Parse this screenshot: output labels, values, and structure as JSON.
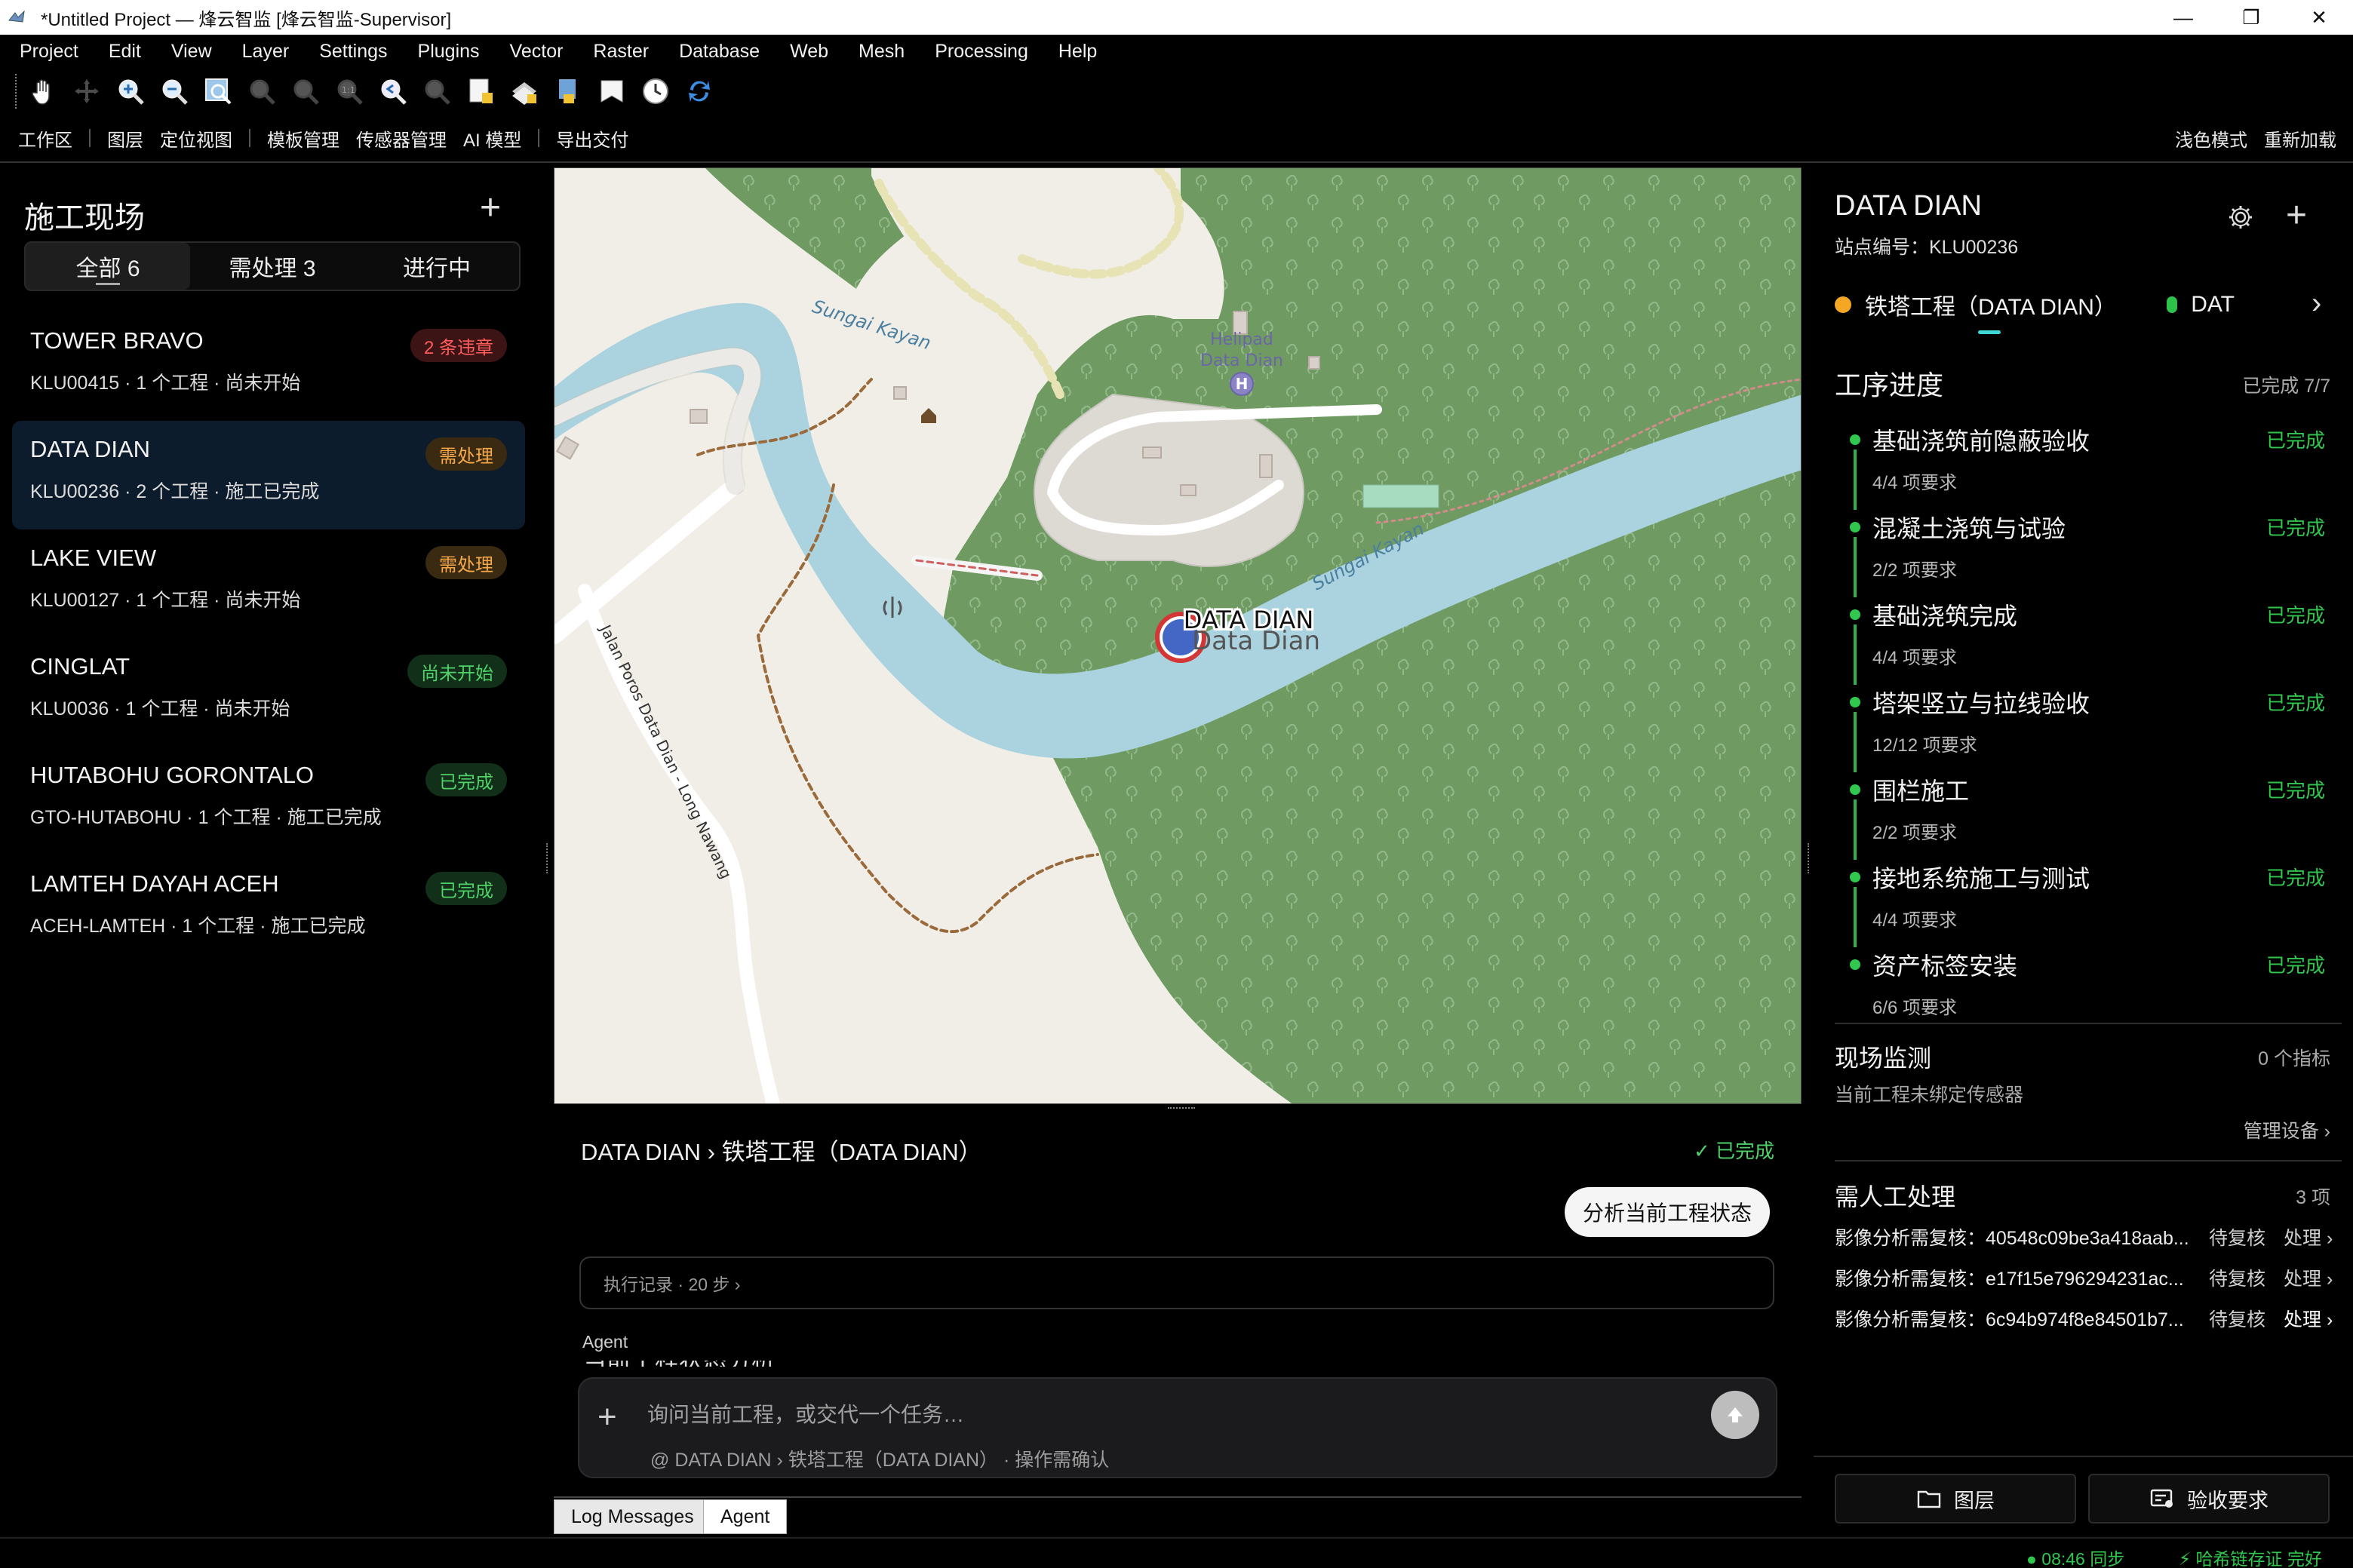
{
  "window": {
    "title": "*Untitled Project — 烽云智监 [烽云智监-Supervisor]",
    "controls": [
      "—",
      "❐",
      "✕"
    ]
  },
  "menu": [
    "Project",
    "Edit",
    "View",
    "Layer",
    "Settings",
    "Plugins",
    "Vector",
    "Raster",
    "Database",
    "Web",
    "Mesh",
    "Processing",
    "Help"
  ],
  "toolbar_icons": [
    "pan-hand-icon",
    "pan-to-selection-icon",
    "zoom-in-icon",
    "zoom-out-icon",
    "zoom-full-icon",
    "zoom-to-selection-icon",
    "zoom-to-layer-icon",
    "zoom-native-icon",
    "zoom-last-icon",
    "zoom-next-icon",
    "new-bookmark-icon",
    "show-bookmarks-icon",
    "new-map-view-icon",
    "new-3d-view-icon",
    "temporal-controller-icon",
    "refresh-icon"
  ],
  "nav": {
    "left": [
      "工作区",
      "图层",
      "定位视图",
      "模板管理",
      "传感器管理",
      "AI 模型",
      "导出交付"
    ],
    "right": [
      "浅色模式",
      "重新加载"
    ]
  },
  "sites_panel": {
    "title": "施工现场",
    "add": "+",
    "filters": [
      "全部 6",
      "需处理 3",
      "进行中"
    ],
    "active_filter": 0,
    "items": [
      {
        "name": "TOWER BRAVO",
        "meta": "KLU00415 · 1 个工程 · 尚未开始",
        "badge": "2 条违章",
        "badge_type": "red"
      },
      {
        "name": "DATA DIAN",
        "meta": "KLU00236 · 2 个工程 · 施工已完成",
        "badge": "需处理",
        "badge_type": "orange",
        "selected": true
      },
      {
        "name": "LAKE VIEW",
        "meta": "KLU00127 · 1 个工程 · 尚未开始",
        "badge": "需处理",
        "badge_type": "orange"
      },
      {
        "name": "CINGLAT",
        "meta": "KLU0036 · 1 个工程 · 尚未开始",
        "badge": "尚未开始",
        "badge_type": "green"
      },
      {
        "name": "HUTABOHU GORONTALO",
        "meta": "GTO-HUTABOHU · 1 个工程 · 施工已完成",
        "badge": "已完成",
        "badge_type": "green"
      },
      {
        "name": "LAMTEH DAYAH ACEH",
        "meta": "ACEH-LAMTEH · 1 个工程 · 施工已完成",
        "badge": "已完成",
        "badge_type": "green"
      }
    ]
  },
  "map": {
    "river_label_1": "Sungai Kayan",
    "river_label_2": "Sungai Kayan",
    "helipad_line1": "Helipad",
    "helipad_line2": "Data Dian",
    "helipad_symbol": "H",
    "road_label": "Jalan Poros Data Dian - Long Nawang",
    "site_label_main": "DATA DIAN",
    "site_label_shadow": "Data Dian",
    "colors": {
      "land": "#f1eee8",
      "forest": "#6f9a62",
      "water": "#aad3df",
      "village": "#dddad4"
    }
  },
  "agent": {
    "breadcrumb": "DATA DIAN › 铁塔工程（DATA DIAN）",
    "status": "✓ 已完成",
    "user_message": "分析当前工程状态",
    "exec_log": "执行记录 · 20 步 ›",
    "agent_label": "Agent",
    "agent_heading_partial": "当前工程状态分析",
    "input_placeholder": "询问当前工程，或交代一个任务…",
    "input_context": "@ DATA DIAN › 铁塔工程（DATA DIAN） · 操作需确认"
  },
  "bottom_tabs": [
    "Log Messages",
    "Agent"
  ],
  "detail": {
    "title": "DATA DIAN",
    "station": "站点编号：KLU00236",
    "projects": [
      {
        "name": "铁塔工程（DATA DIAN）",
        "color": "#f5a623"
      },
      {
        "name": "DAT",
        "color": "#2ec24a"
      }
    ],
    "next": "›",
    "progress_title": "工序进度",
    "progress_summary": "已完成 7/7",
    "steps": [
      {
        "name": "基础浇筑前隐蔽验收",
        "req": "4/4 项要求",
        "status": "已完成"
      },
      {
        "name": "混凝土浇筑与试验",
        "req": "2/2 项要求",
        "status": "已完成"
      },
      {
        "name": "基础浇筑完成",
        "req": "4/4 项要求",
        "status": "已完成"
      },
      {
        "name": "塔架竖立与拉线验收",
        "req": "12/12 项要求",
        "status": "已完成"
      },
      {
        "name": "围栏施工",
        "req": "2/2 项要求",
        "status": "已完成"
      },
      {
        "name": "接地系统施工与测试",
        "req": "4/4 项要求",
        "status": "已完成"
      },
      {
        "name": "资产标签安装",
        "req": "6/6 项要求",
        "status": "已完成"
      }
    ],
    "monitor_title": "现场监测",
    "monitor_count": "0 个指标",
    "monitor_note": "当前工程未绑定传感器",
    "manage_devices": "管理设备 ›",
    "manual_title": "需人工处理",
    "manual_count": "3 项",
    "manual_items": [
      {
        "text": "影像分析需复核：40548c09be3a418aab...",
        "status": "待复核",
        "action": "处理 ›"
      },
      {
        "text": "影像分析需复核：e17f15e796294231ac...",
        "status": "待复核",
        "action": "处理 ›"
      },
      {
        "text": "影像分析需复核：6c94b974f8e84501b7...",
        "status": "待复核",
        "action": "处理 ›"
      }
    ],
    "btn_layers": "图层",
    "btn_acceptance": "验收要求"
  },
  "statusbar": {
    "sync": "● 08:46 同步",
    "chain": "⚡ 哈希链存证 完好"
  }
}
